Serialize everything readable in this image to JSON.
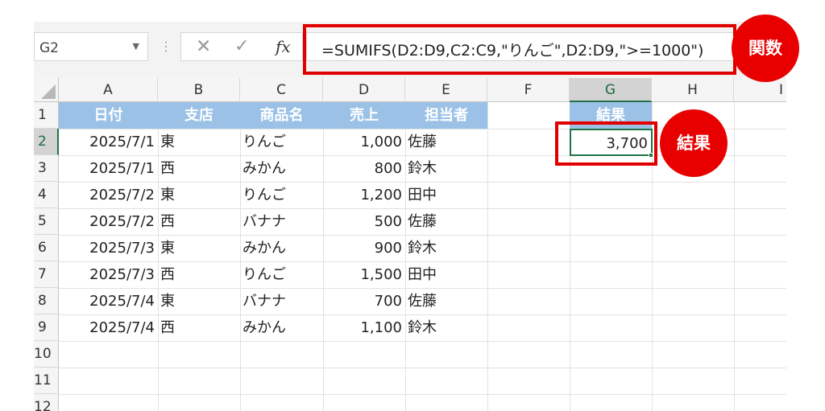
{
  "name_box": {
    "value": "G2"
  },
  "formula_bar": {
    "cancel_icon": "✕",
    "enter_icon": "✓",
    "fx_label": "fx",
    "formula": "=SUMIFS(D2:D9,C2:C9,\"りんご\",D2:D9,\">=1000\")"
  },
  "sheet": {
    "columns": [
      "A",
      "B",
      "C",
      "D",
      "E",
      "F",
      "G",
      "H",
      "I"
    ],
    "rows": [
      "1",
      "2",
      "3",
      "4",
      "5",
      "6",
      "7",
      "8",
      "9",
      "10",
      "11",
      "12"
    ],
    "headers": [
      "日付",
      "支店",
      "商品名",
      "売上",
      "担当者"
    ],
    "data": [
      [
        "2025/7/1",
        "東",
        "りんご",
        "1,000",
        "佐藤"
      ],
      [
        "2025/7/1",
        "西",
        "みかん",
        "800",
        "鈴木"
      ],
      [
        "2025/7/2",
        "東",
        "りんご",
        "1,200",
        "田中"
      ],
      [
        "2025/7/2",
        "西",
        "バナナ",
        "500",
        "佐藤"
      ],
      [
        "2025/7/3",
        "東",
        "みかん",
        "900",
        "鈴木"
      ],
      [
        "2025/7/3",
        "西",
        "りんご",
        "1,500",
        "田中"
      ],
      [
        "2025/7/4",
        "東",
        "バナナ",
        "700",
        "佐藤"
      ],
      [
        "2025/7/4",
        "西",
        "みかん",
        "1,100",
        "鈴木"
      ]
    ],
    "result_header": "結果",
    "result_value": "3,700",
    "selected_cell": "G2"
  },
  "annotations": {
    "function_badge": "関数",
    "result_badge": "結果"
  },
  "colors": {
    "header_fill": "#9bc2e6",
    "selection": "#217346",
    "annotation_red": "#e80000"
  }
}
